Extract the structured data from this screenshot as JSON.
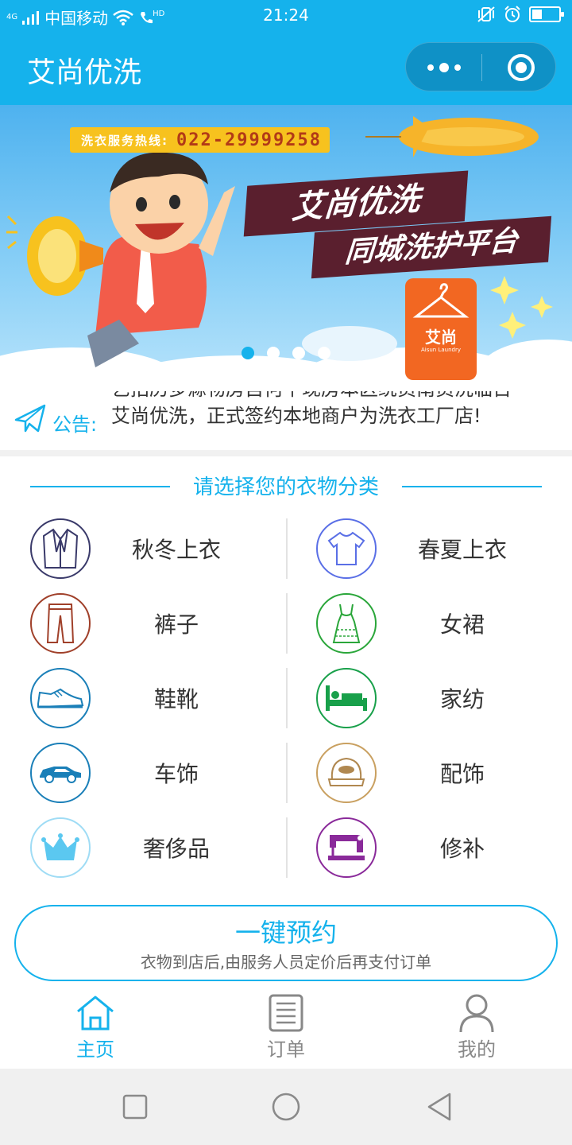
{
  "status_bar": {
    "network": "4G",
    "carrier": "中国移动",
    "hd": "HD",
    "time": "21:24"
  },
  "header": {
    "title": "艾尚优洗",
    "more_icon": "ellipsis-icon",
    "close_icon": "target-icon"
  },
  "banner": {
    "hotline_label": "洗衣服务热线:",
    "hotline_number": "022-29999258",
    "slogan_line1": "艾尚优洗",
    "slogan_line2": "同城洗护平台",
    "logo_text": "艾尚",
    "logo_subtext": "Aisun Laundry",
    "slide_count": 4,
    "active_slide": 1
  },
  "notice": {
    "label": "公告:",
    "previous_line": "艺招历多滁物房自何平现房本区统员南员洗临百",
    "current_line": "艾尚优洗，正式签约本地商户为洗衣工厂店!"
  },
  "section": {
    "title": "请选择您的衣物分类"
  },
  "categories": [
    {
      "label": "秋冬上衣",
      "icon": "suit-jacket-icon",
      "color": "#4a4a8a"
    },
    {
      "label": "春夏上衣",
      "icon": "t-shirt-icon",
      "color": "#5a6fe6"
    },
    {
      "label": "裤子",
      "icon": "trousers-icon",
      "color": "#a0402a"
    },
    {
      "label": "女裙",
      "icon": "dress-icon",
      "color": "#2aa63a"
    },
    {
      "label": "鞋靴",
      "icon": "sneaker-icon",
      "color": "#1a7fb8"
    },
    {
      "label": "家纺",
      "icon": "bed-icon",
      "color": "#18a04a"
    },
    {
      "label": "车饰",
      "icon": "car-icon",
      "color": "#1a7fb8"
    },
    {
      "label": "配饰",
      "icon": "cap-icon",
      "color": "#c9a060"
    },
    {
      "label": "奢侈品",
      "icon": "crown-icon",
      "color": "#5bc8f0"
    },
    {
      "label": "修补",
      "icon": "sewing-machine-icon",
      "color": "#8a2a9a"
    }
  ],
  "booking": {
    "title": "一键预约",
    "subtitle": "衣物到店后,由服务人员定价后再支付订单"
  },
  "tabs": [
    {
      "label": "主页",
      "icon": "home-icon",
      "active": true
    },
    {
      "label": "订单",
      "icon": "order-list-icon",
      "active": false
    },
    {
      "label": "我的",
      "icon": "user-icon",
      "active": false
    }
  ],
  "colors": {
    "primary": "#15b2ec",
    "capsule": "#0f91c6",
    "text": "#333333"
  }
}
